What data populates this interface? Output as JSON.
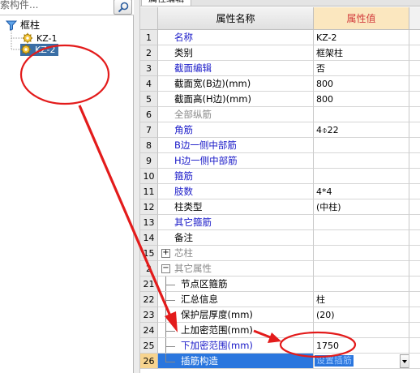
{
  "left_panel": {
    "search": {
      "placeholder": "索构件..."
    },
    "tree": {
      "root": {
        "label": "框柱"
      },
      "items": [
        {
          "label": "KZ-1",
          "selected": false
        },
        {
          "label": "KZ-2",
          "selected": true
        }
      ]
    }
  },
  "right_panel": {
    "tab": {
      "label": "属性编辑"
    },
    "grid": {
      "columns": {
        "name": "属性名称",
        "value": "属性值"
      },
      "rows": [
        {
          "num": "1",
          "name": "名称",
          "value": "KZ-2"
        },
        {
          "num": "2",
          "name": "类别",
          "value": "框架柱"
        },
        {
          "num": "3",
          "name": "截面编辑",
          "value": "否"
        },
        {
          "num": "4",
          "name": "截面宽(B边)(mm)",
          "value": "800"
        },
        {
          "num": "5",
          "name": "截面高(H边)(mm)",
          "value": "800"
        },
        {
          "num": "6",
          "name": "全部纵筋",
          "value": ""
        },
        {
          "num": "7",
          "name": "角筋",
          "value": "4⌽22"
        },
        {
          "num": "8",
          "name": "B边一侧中部筋",
          "value": ""
        },
        {
          "num": "9",
          "name": "H边一侧中部筋",
          "value": ""
        },
        {
          "num": "10",
          "name": "箍筋",
          "value": ""
        },
        {
          "num": "11",
          "name": "肢数",
          "value": "4*4"
        },
        {
          "num": "12",
          "name": "柱类型",
          "value": "(中柱)"
        },
        {
          "num": "13",
          "name": "其它箍筋",
          "value": ""
        },
        {
          "num": "14",
          "name": "备注",
          "value": ""
        },
        {
          "num": "15",
          "name": "芯柱",
          "value": "",
          "expand": "+"
        },
        {
          "num": "2",
          "name": "其它属性",
          "value": "",
          "expand": "−"
        },
        {
          "num": "21",
          "name": "节点区箍筋",
          "value": ""
        },
        {
          "num": "22",
          "name": "汇总信息",
          "value": "柱"
        },
        {
          "num": "23",
          "name": "保护层厚度(mm)",
          "value": "(20)"
        },
        {
          "num": "24",
          "name": "上加密范围(mm)",
          "value": ""
        },
        {
          "num": "25",
          "name": "下加密范围(mm)",
          "value": "1750"
        },
        {
          "num": "26",
          "name": "插筋构造",
          "value": "设置插筋",
          "selected": true
        }
      ]
    }
  },
  "colors": {
    "selection_blue": "#2a76de",
    "tree_selection": "#3a6ea5",
    "header_value_bg": "#fbe7bf",
    "header_value_text": "#d23c3c",
    "link_blue": "#1a1ac8",
    "annotation_red": "#e31b1b"
  },
  "icons": {
    "search": "search-icon",
    "root": "funnel-icon",
    "item": "gear-icon"
  }
}
